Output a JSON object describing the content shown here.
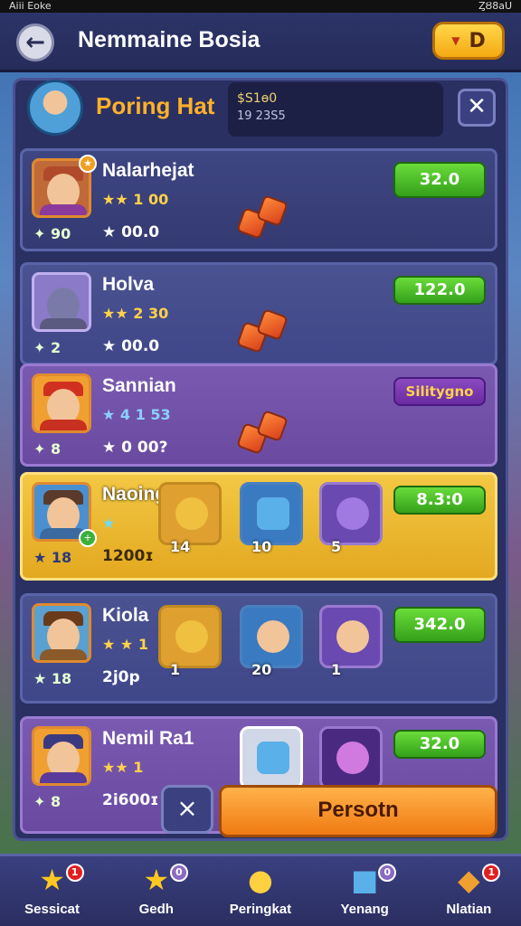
{
  "status_bar": {
    "left": "Aiii Eoke",
    "right": "ȤȢ8aU"
  },
  "header": {
    "title": "Nemmaine Bosia",
    "coin_value": "D"
  },
  "panel": {
    "title": "Poring Hat",
    "info_line1": "$S1ѳ0",
    "info_line2": "19 23S5"
  },
  "rows": [
    {
      "name": "Nalarhejat",
      "rating": "★★ 1 00",
      "level": "✦ 90",
      "score": "★ 00.0",
      "price": "32.0"
    },
    {
      "name": "Holva",
      "rating": "★★ 2 30",
      "level": "✦ 2",
      "score": "★ 00.0",
      "price": "122.0"
    },
    {
      "name": "Sannian",
      "rating": "★ 4 1 53",
      "level": "✦ 8",
      "score": "★ 0 00?",
      "price": "Silitygno"
    },
    {
      "name": "Naoingiat",
      "rating": "★",
      "level": "★ 18",
      "score": "1200ɪ",
      "price": "8.3:0",
      "items": [
        {
          "count": "14"
        },
        {
          "count": "10"
        },
        {
          "count": "5"
        }
      ]
    },
    {
      "name": "Kiola",
      "rating": "★ ★ 1",
      "level": "★ 18",
      "score": "2j0p",
      "price": "342.0",
      "items": [
        {
          "count": "1"
        },
        {
          "count": "20"
        },
        {
          "count": "1"
        }
      ]
    },
    {
      "name": "Nemil Ra1",
      "rating": "★★ 1",
      "level": "✦ 8",
      "score": "2i600ɪ",
      "price": "32.0"
    }
  ],
  "buttons": {
    "primary": "Persotn",
    "cancel": "×"
  },
  "nav": [
    {
      "label": "Sessicat",
      "icon": "star-icon",
      "badge": "1"
    },
    {
      "label": "Gedh",
      "icon": "star-icon",
      "badge": "0"
    },
    {
      "label": "Peringkat",
      "icon": "creature-icon",
      "badge": ""
    },
    {
      "label": "Yenang",
      "icon": "gift-icon",
      "badge": "0"
    },
    {
      "label": "Nlatian",
      "icon": "helmet-icon",
      "badge": "1"
    }
  ],
  "colors": {
    "accent": "#ffb12a",
    "green": "#34a01a",
    "panel": "#2a3062"
  }
}
